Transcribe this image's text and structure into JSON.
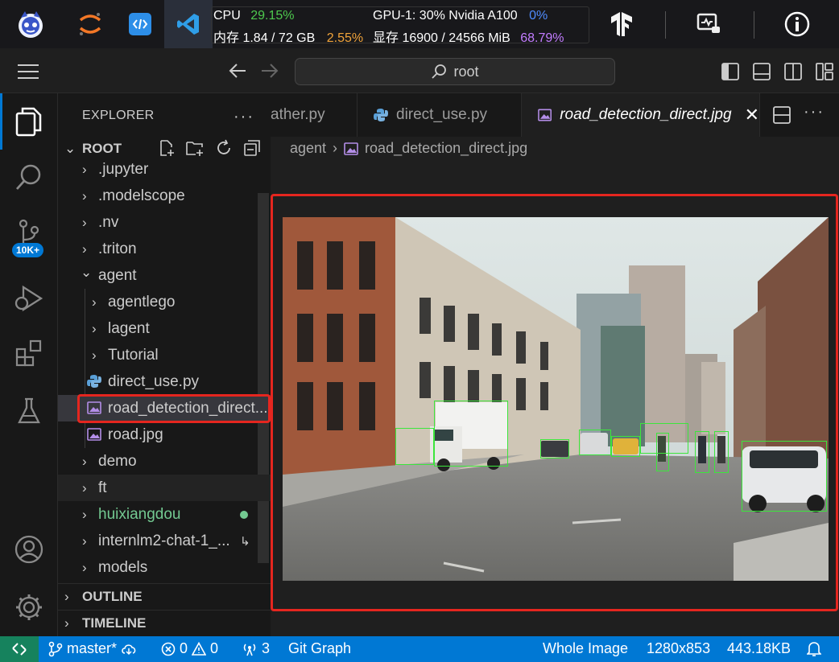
{
  "topbar": {
    "cpu_label": "CPU",
    "cpu_pct": "29.15%",
    "mem_label": "内存 1.84 / 72 GB",
    "mem_pct": "2.55%",
    "gpu_label": "GPU-1: 30% Nvidia A100",
    "gpu_pct": "0%",
    "vram_label": "显存 16900 / 24566 MiB",
    "vram_pct": "68.79%"
  },
  "titlebar": {
    "search_text": "root"
  },
  "activity": {
    "badge": "10K+"
  },
  "sidebar": {
    "title": "EXPLORER",
    "root_label": "ROOT",
    "items": [
      {
        "label": ".jupyter"
      },
      {
        "label": ".modelscope"
      },
      {
        "label": ".nv"
      },
      {
        "label": ".triton"
      },
      {
        "label": "agent"
      },
      {
        "label": "agentlego"
      },
      {
        "label": "lagent"
      },
      {
        "label": "Tutorial"
      },
      {
        "label": "direct_use.py"
      },
      {
        "label": "road_detection_direct..."
      },
      {
        "label": "road.jpg"
      },
      {
        "label": "demo"
      },
      {
        "label": "ft"
      },
      {
        "label": "huixiangdou"
      },
      {
        "label": "internlm2-chat-1_..."
      },
      {
        "label": "models"
      }
    ],
    "outline_label": "OUTLINE",
    "timeline_label": "TIMELINE"
  },
  "tabs": [
    {
      "label": "ather.py"
    },
    {
      "label": "direct_use.py"
    },
    {
      "label": "road_detection_direct.jpg"
    }
  ],
  "breadcrumb": {
    "folder": "agent",
    "file": "road_detection_direct.jpg"
  },
  "statusbar": {
    "branch": "master*",
    "errors": "0",
    "warnings": "0",
    "ports": "3",
    "git_graph": "Git Graph",
    "view_mode": "Whole Image",
    "dimensions": "1280x853",
    "file_size": "443.18KB"
  },
  "colors": {
    "accent_blue": "#0078d4",
    "cpu_green": "#4ec94e",
    "mem_orange": "#f0a33a",
    "gpu_blue": "#4f8cff",
    "vram_purple": "#c27cff",
    "highlight_red": "#e5261f",
    "git_green": "#73c991"
  }
}
